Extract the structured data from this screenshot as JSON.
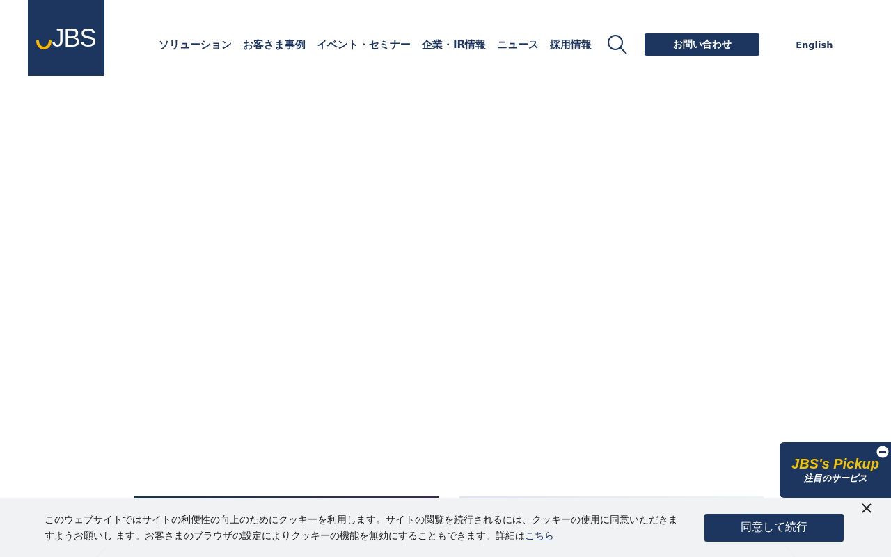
{
  "header": {
    "logo": "JBS",
    "nav": [
      "ソリューション",
      "お客さま事例",
      "イベント・セミナー",
      "企業・IR情報",
      "ニュース",
      "採用情報"
    ],
    "contact_button": "お問い合わせ",
    "language_link": "English"
  },
  "pickup": {
    "title": "JBS's Pickup",
    "subtitle": "注目のサービス"
  },
  "cookie_bar": {
    "message": "このウェブサイトではサイトの利便性の向上のためにクッキーを利用します。サイトの閲覧を続行されるには、クッキーの使用に同意いただきますようお願いし ます。お客さまのブラウザの設定によりクッキーの機能を無効にすることもできます。詳細は",
    "link": "こちら",
    "accept_button": "同意して続行"
  }
}
